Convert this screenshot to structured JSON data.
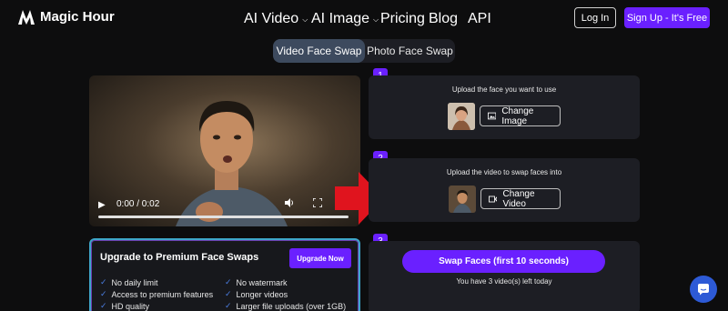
{
  "nav": {
    "brand": "Magic Hour",
    "links": [
      {
        "label": "AI Video",
        "has_dropdown": true
      },
      {
        "label": "AI Image",
        "has_dropdown": true
      },
      {
        "label": "Pricing",
        "has_dropdown": false
      },
      {
        "label": "Blog",
        "has_dropdown": false
      },
      {
        "label": "API",
        "has_dropdown": false
      }
    ],
    "login_label": "Log In",
    "signup_label": "Sign Up  - It's Free"
  },
  "tabs": [
    {
      "label": "Video Face Swap",
      "active": true
    },
    {
      "label": "Photo Face Swap",
      "active": false
    }
  ],
  "video": {
    "time": "0:00 / 0:02"
  },
  "steps": [
    {
      "number": "1",
      "caption": "Upload the face you want to use",
      "button_label": "Change Image"
    },
    {
      "number": "2",
      "caption": "Upload the video to swap faces into",
      "button_label": "Change Video"
    },
    {
      "number": "3",
      "button_label": "Swap Faces (first 10 seconds)",
      "note": "You have 3 video(s) left today"
    }
  ],
  "premium": {
    "title": "Upgrade to Premium Face Swaps",
    "upgrade_label": "Upgrade Now",
    "features_left": [
      "No daily limit",
      "Access to premium features",
      "HD quality"
    ],
    "features_right": [
      "No watermark",
      "Longer videos",
      "Larger file uploads (over 1GB)"
    ]
  },
  "colors": {
    "accent": "#6a20ff",
    "background": "#0d0d0e",
    "panel": "#1d1e24",
    "arrow": "#e0141e"
  }
}
